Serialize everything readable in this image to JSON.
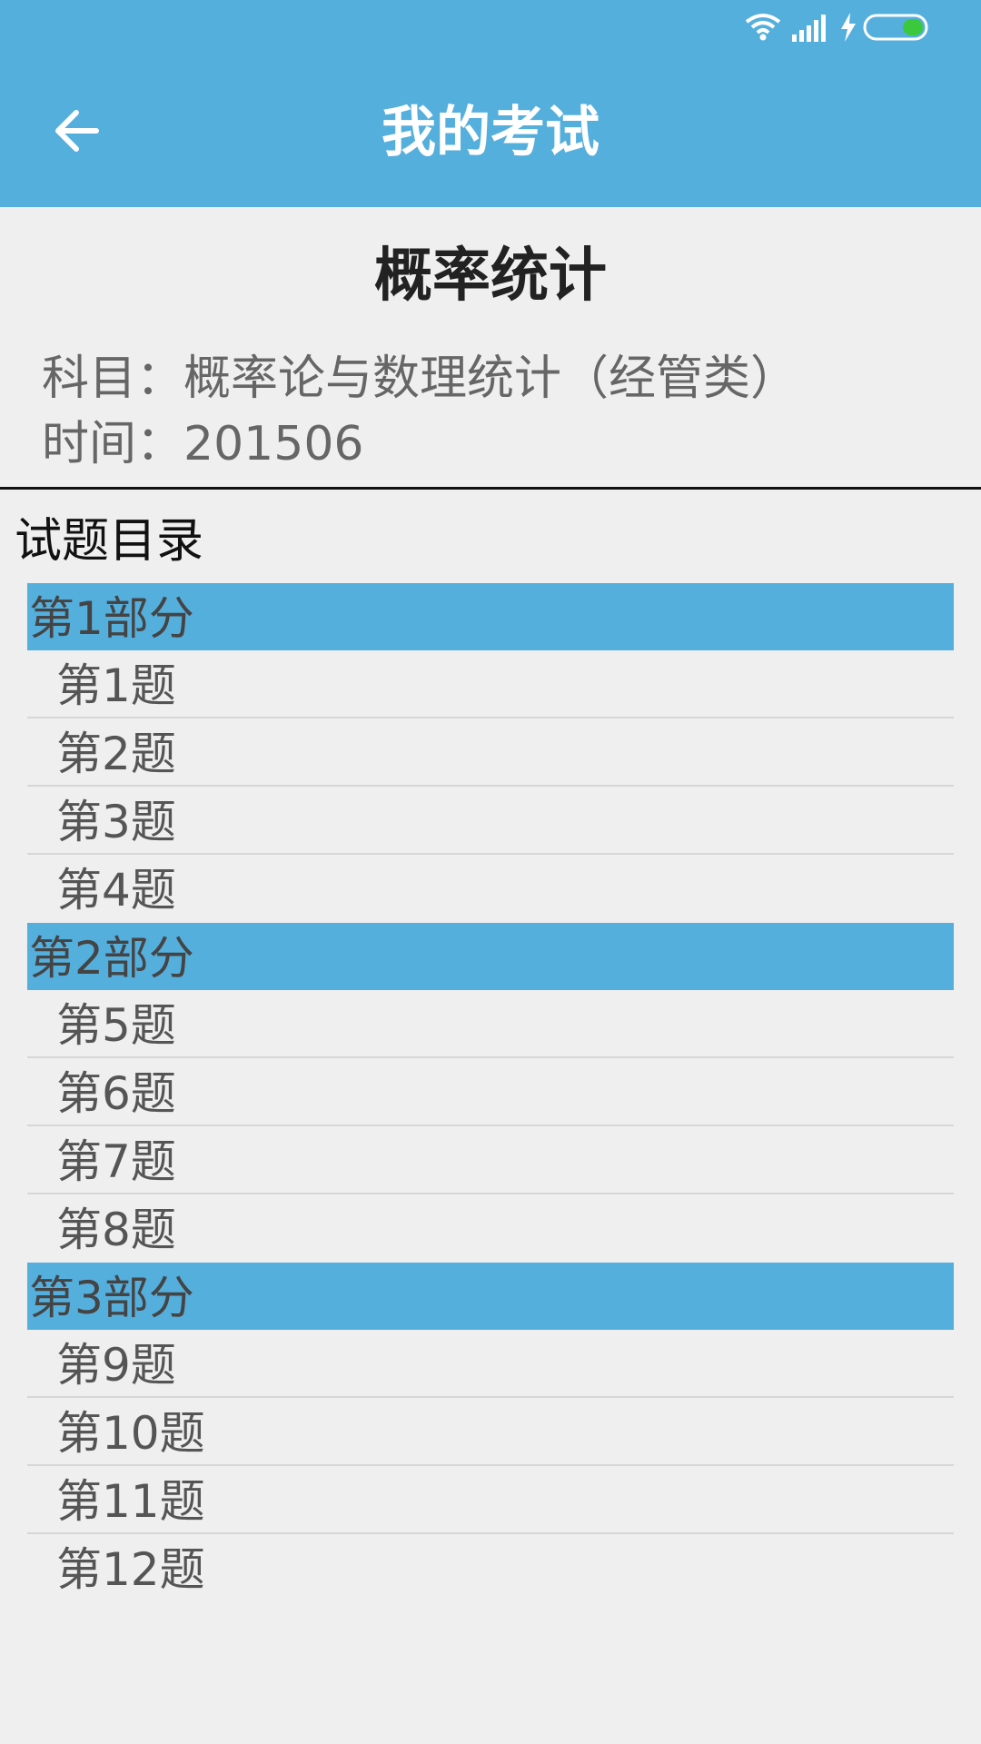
{
  "header": {
    "title": "我的考试",
    "back_icon": "arrow-left-icon"
  },
  "status_bar": {
    "icons": [
      "wifi-icon",
      "signal-icon",
      "charging-icon",
      "battery-icon"
    ],
    "battery_color": "#3cc83c"
  },
  "exam": {
    "title": "概率统计",
    "subject": "科目：概率论与数理统计（经管类）",
    "time": "时间：201506"
  },
  "toc": {
    "heading": "试题目录",
    "sections": [
      {
        "label": "第1部分",
        "questions": [
          "第1题",
          "第2题",
          "第3题",
          "第4题"
        ]
      },
      {
        "label": "第2部分",
        "questions": [
          "第5题",
          "第6题",
          "第7题",
          "第8题"
        ]
      },
      {
        "label": "第3部分",
        "questions": [
          "第9题",
          "第10题",
          "第11题",
          "第12题"
        ]
      }
    ]
  },
  "colors": {
    "primary": "#55afdd",
    "background": "#efefef"
  }
}
